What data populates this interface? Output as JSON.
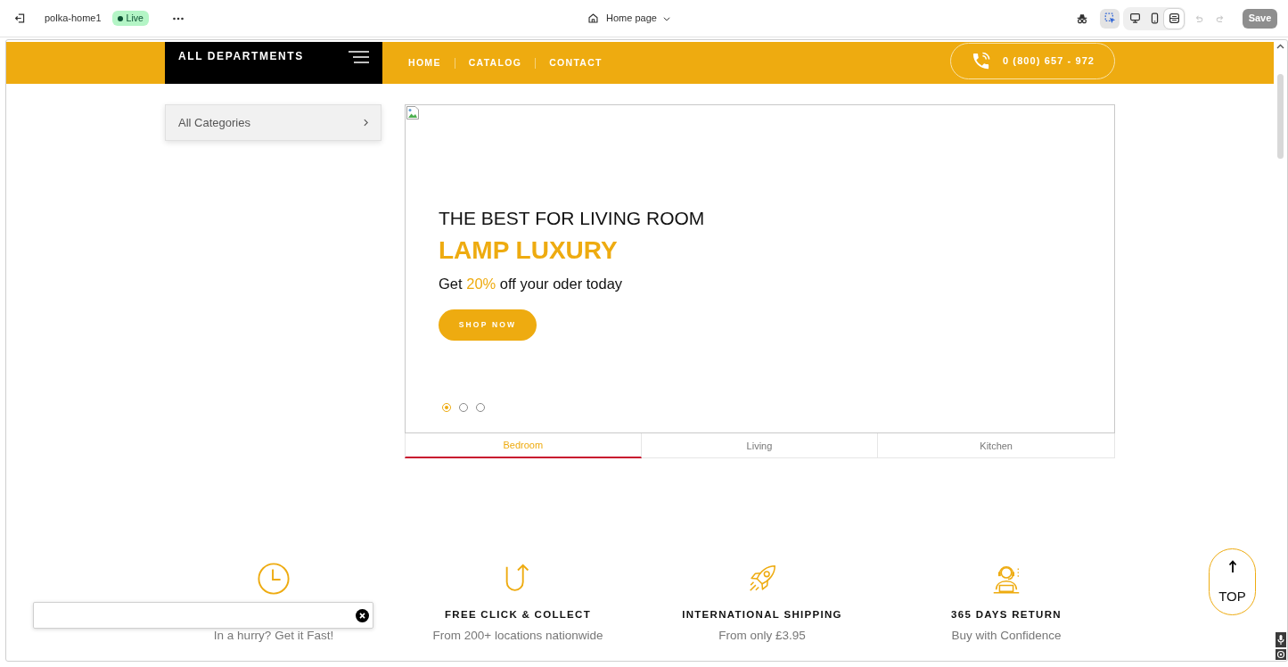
{
  "editor_bar": {
    "page_name": "polka-home1",
    "status": "Live",
    "page": "Home page",
    "tools": [
      {
        "kind": "incognito",
        "selected": false
      },
      {
        "kind": "select",
        "selected": true
      }
    ],
    "viewports": [
      {
        "kind": "desktop",
        "selected": false
      },
      {
        "kind": "mobile",
        "selected": false
      },
      {
        "kind": "fullwidth",
        "selected": true
      }
    ],
    "history": [
      {
        "kind": "undo",
        "disabled": true
      },
      {
        "kind": "redo",
        "disabled": true
      }
    ],
    "save": {
      "label": "Save",
      "disabled": true
    }
  },
  "header": {
    "departments": "ALL DEPARTMENTS",
    "nav": [
      "HOME",
      "CATALOG",
      "CONTACT"
    ],
    "phone": "0 (800) 657 - 972"
  },
  "sidebar": {
    "categories": "All Categories"
  },
  "hero": {
    "headline": "THE BEST FOR LIVING ROOM",
    "title": "LAMP LUXURY",
    "offer": [
      {
        "text": "Get",
        "highlight": false
      },
      {
        "text": "20%",
        "highlight": true
      },
      {
        "text": "off your oder today",
        "highlight": false
      }
    ],
    "button": "SHOP NOW",
    "slides": [
      {
        "selected": true
      },
      {
        "selected": false
      },
      {
        "selected": false
      }
    ]
  },
  "tabs": [
    {
      "label": "Bedroom",
      "selected": true
    },
    {
      "label": "Living",
      "selected": false
    },
    {
      "label": "Kitchen",
      "selected": false
    }
  ],
  "features": [
    {
      "kind": "clock",
      "subtitle": "In a hurry? Get it Fast!"
    },
    {
      "kind": "u-turn",
      "title": "FREE CLICK & COLLECT",
      "subtitle": "From 200+ locations nationwide"
    },
    {
      "kind": "rocket",
      "title": "INTERNATIONAL SHIPPING",
      "subtitle": "From only £3.95"
    },
    {
      "kind": "support",
      "title": "365 DAYS RETURN",
      "subtitle": "Buy with Confidence"
    }
  ],
  "back_to_top": "TOP"
}
